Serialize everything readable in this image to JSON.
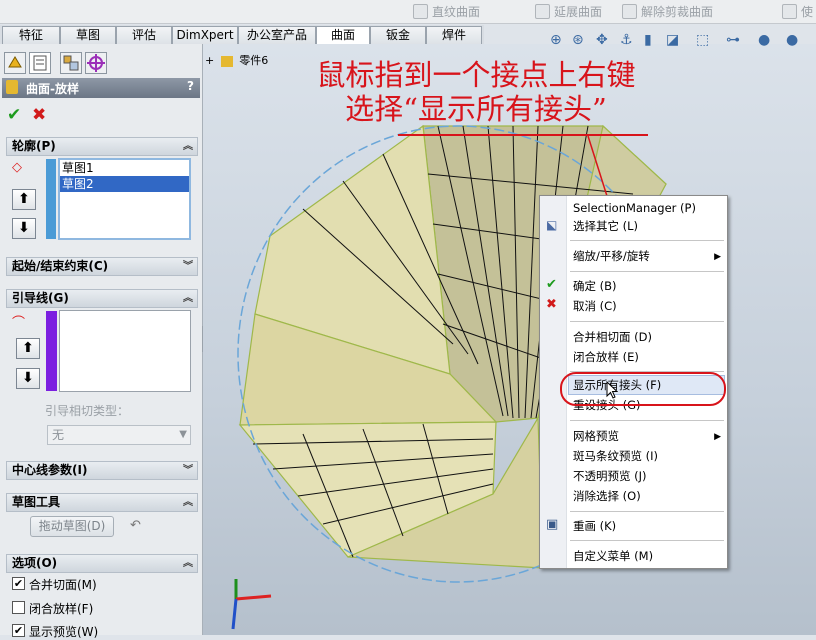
{
  "toolbar": {
    "flat_surface": "直纹曲面",
    "extend_surface": "延展曲面",
    "untrim_surface": "解除剪裁曲面",
    "right_partial": "使"
  },
  "tabs": [
    "特征",
    "草图",
    "评估",
    "DimXpert",
    "办公室产品",
    "曲面",
    "钣金",
    "焊件"
  ],
  "active_tab": "曲面",
  "feature_tree_item": "零件6",
  "property_manager": {
    "title": "曲面-放样",
    "help": "?",
    "ok": "✔",
    "cancel": "✖",
    "profiles": {
      "header": "轮廓(P)",
      "items": [
        "草图1",
        "草图2"
      ],
      "selected": "草图2"
    },
    "start_end": "起始/结束约束(C)",
    "guides": {
      "header": "引导线(G)",
      "tangency_label": "引导相切类型：",
      "tangency_value": "无"
    },
    "centerline": "中心线参数(I)",
    "sketch_tools": {
      "header": "草图工具",
      "drag_button": "拖动草图(D)"
    },
    "options": {
      "header": "选项(O)",
      "items": [
        {
          "label": "合并切面(M)",
          "checked": true
        },
        {
          "label": "闭合放样(F)",
          "checked": false
        },
        {
          "label": "显示预览(W)",
          "checked": true
        }
      ]
    }
  },
  "annotation": {
    "line1": "鼠标指到一个接点上右键",
    "line2": "选择“显示所有接头”"
  },
  "context_menu": {
    "items": [
      {
        "label": "SelectionManager (P)",
        "group": 0
      },
      {
        "label": "选择其它 (L)",
        "group": 0
      },
      {
        "label": "缩放/平移/旋转",
        "group": 1,
        "submenu": true
      },
      {
        "label": "确定 (B)",
        "group": 2
      },
      {
        "label": "取消 (C)",
        "group": 2
      },
      {
        "label": "合并相切面 (D)",
        "group": 3
      },
      {
        "label": "闭合放样 (E)",
        "group": 3
      },
      {
        "label": "显示所有接头 (F)",
        "group": 4,
        "highlighted": true
      },
      {
        "label": "重设接头 (G)",
        "group": 4
      },
      {
        "label": "网格预览",
        "group": 5,
        "submenu": true
      },
      {
        "label": "斑马条纹预览 (I)",
        "group": 5
      },
      {
        "label": "不透明预览 (J)",
        "group": 5
      },
      {
        "label": "消除选择 (O)",
        "group": 5
      },
      {
        "label": "重画 (K)",
        "group": 6
      },
      {
        "label": "自定义菜单 (M)",
        "group": 7
      }
    ]
  },
  "colors": {
    "annotation_red": "#d8141b",
    "surface_fill": "#dcd9a8",
    "selection_blue": "#3168c5",
    "guide_purple": "#7b1fe0"
  },
  "icons": [
    "ruled-surface-icon",
    "extend-surface-icon",
    "untrim-surface-icon",
    "zoom-fit-icon",
    "zoom-area-icon",
    "pan-icon",
    "rotate-icon",
    "view-orientation-icon",
    "display-style-icon",
    "check-icon",
    "close-icon",
    "arrow-up-icon",
    "arrow-down-icon",
    "triad-icon"
  ]
}
